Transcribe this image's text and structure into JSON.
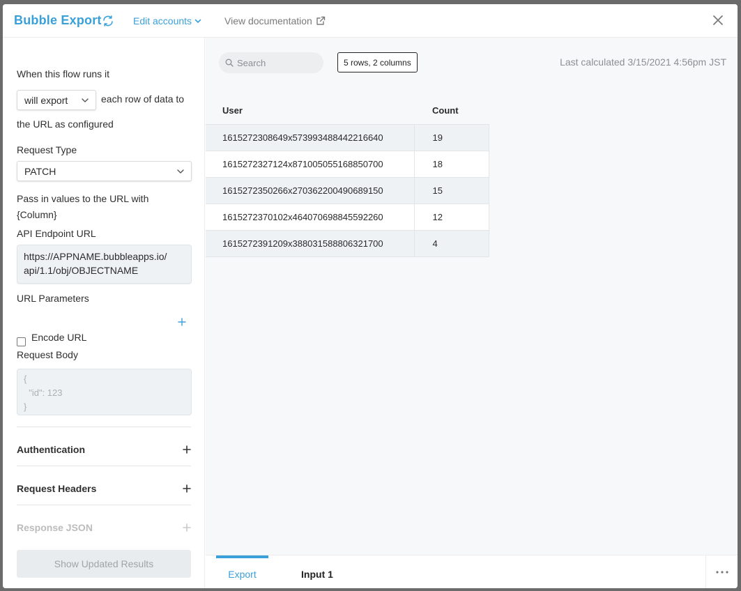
{
  "header": {
    "title": "Bubble Export",
    "edit_accounts": "Edit accounts",
    "view_documentation": "View documentation"
  },
  "left": {
    "flow_label": "When this flow runs it",
    "flow_select": "will export",
    "flow_suffix": "each row of data to",
    "flow_suffix2": "the URL as configured",
    "request_type_label": "Request Type",
    "request_type_value": "PATCH",
    "pass_values_line1": "Pass in values to the URL with",
    "pass_values_line2": "{Column}",
    "endpoint_label": "API Endpoint URL",
    "endpoint_line1": "https://APPNAME.bubbleapps.io/",
    "endpoint_line2": "api/1.1/obj/OBJECTNAME",
    "url_params_label": "URL Parameters",
    "encode_url_label": "Encode URL",
    "request_body_label": "Request Body",
    "request_body_placeholder": "{\n  \"id\": 123\n}",
    "sections": {
      "authentication": "Authentication",
      "request_headers": "Request Headers",
      "response_json": "Response JSON"
    },
    "show_results_button": "Show Updated Results"
  },
  "toolbar": {
    "search_placeholder": "Search",
    "rows_badge": "5 rows, 2 columns",
    "last_calculated": "Last calculated 3/15/2021 4:56pm JST"
  },
  "table": {
    "columns": [
      "User",
      "Count"
    ],
    "rows": [
      [
        "1615272308649x573993488442216640",
        "19"
      ],
      [
        "1615272327124x871005055168850700",
        "18"
      ],
      [
        "1615272350266x270362200490689150",
        "15"
      ],
      [
        "1615272370102x464070698845592260",
        "12"
      ],
      [
        "1615272391209x388031588806321700",
        "4"
      ]
    ]
  },
  "tabs": {
    "export": "Export",
    "input": "Input 1"
  },
  "colors": {
    "accent": "#3aa0d9",
    "row_alt": "#eef2f5"
  }
}
